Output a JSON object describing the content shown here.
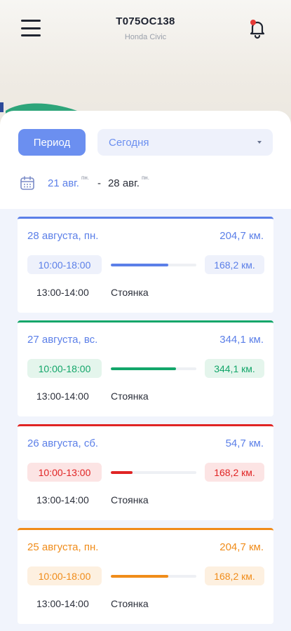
{
  "header": {
    "plate": "Т075ОС138",
    "model": "Honda Civic",
    "menu_icon": "hamburger-menu-icon",
    "bell_icon": "bell-notification-icon",
    "notification_dot_color": "#e53935"
  },
  "filters": {
    "period_label": "Период",
    "range_value": "Сегодня",
    "date_from": "21 авг.",
    "date_from_day": "пн.",
    "date_sep": "-",
    "date_to": "28 авг.",
    "date_to_day": "пн."
  },
  "colors": {
    "accent": "#6b8ff0",
    "list_bg": "#f1f4fc"
  },
  "days": [
    {
      "date": "28 августа, пн.",
      "total": "204,7 км.",
      "time": "10:00-18:00",
      "distance": "168,2 км.",
      "progress": 0.67,
      "stop_time": "13:00-14:00",
      "stop_label": "Стоянка",
      "color": "#5b7fe8",
      "pill_bg": "#eef1fb",
      "text_color": "#5b7fe8",
      "time_text_color": "#5b7fe8"
    },
    {
      "date": "27 августа, вс.",
      "total": "344,1 км.",
      "time": "10:00-18:00",
      "distance": "344,1 км.",
      "progress": 0.76,
      "stop_time": "13:00-14:00",
      "stop_label": "Стоянка",
      "color": "#13a66a",
      "pill_bg": "#e4f5ec",
      "text_color": "#5b7fe8",
      "time_text_color": "#13a66a"
    },
    {
      "date": "26 августа, сб.",
      "total": "54,7 км.",
      "time": "10:00-13:00",
      "distance": "168,2 км.",
      "progress": 0.25,
      "stop_time": "13:00-14:00",
      "stop_label": "Стоянка",
      "color": "#e02424",
      "pill_bg": "#fce4e4",
      "text_color": "#5b7fe8",
      "time_text_color": "#e02424"
    },
    {
      "date": "25 августа, пн.",
      "total": "204,7 км.",
      "time": "10:00-18:00",
      "distance": "168,2 км.",
      "progress": 0.67,
      "stop_time": "13:00-14:00",
      "stop_label": "Стоянка",
      "color": "#f08c1a",
      "pill_bg": "#fdf0e0",
      "text_color": "#f08c1a",
      "time_text_color": "#f08c1a"
    }
  ]
}
